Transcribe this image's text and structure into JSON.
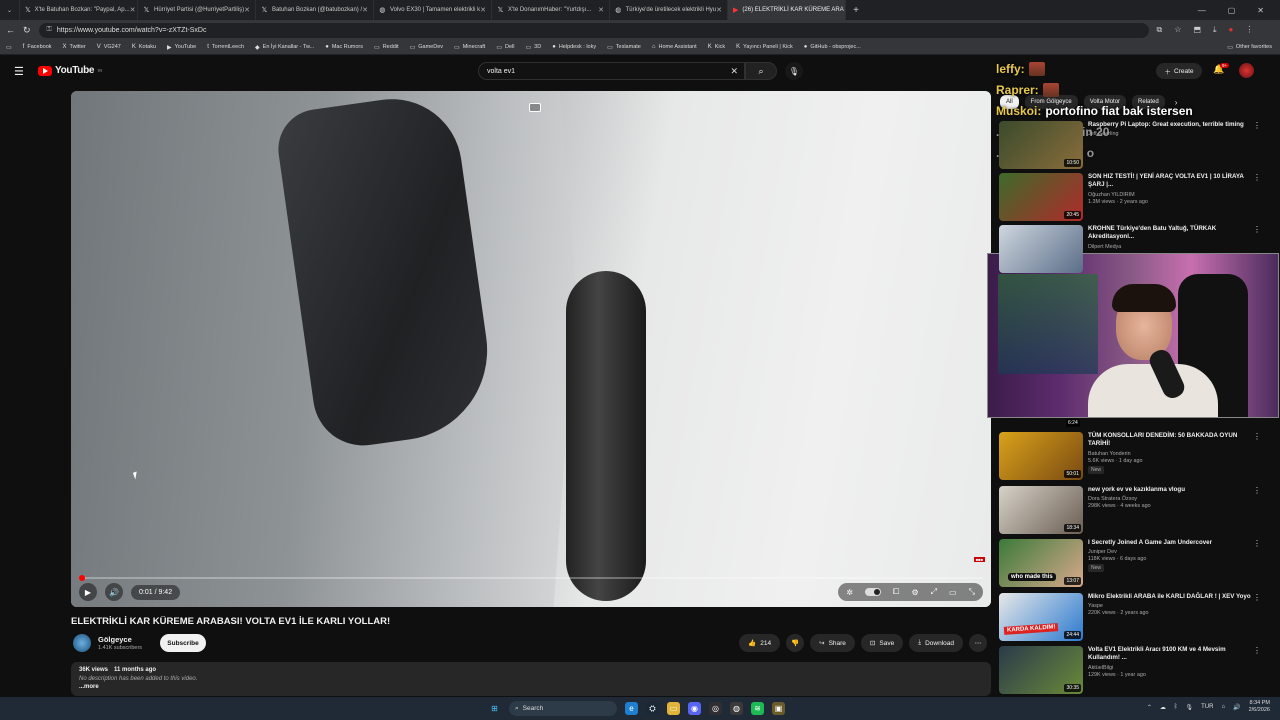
{
  "tabs": [
    {
      "label": "X'te Batuhan Bozkan: \"Paypal, Ap...",
      "icon": "x-icon",
      "active": false
    },
    {
      "label": "Hürriyet Partisi (@HurriyetPartiliş)",
      "icon": "x-icon",
      "active": false
    },
    {
      "label": "Batuhan Bozkan (@batubozkan) /",
      "icon": "x-icon",
      "active": false
    },
    {
      "label": "Volvo EX30 | Tamamen elektrikli k",
      "icon": "globe-icon",
      "active": false
    },
    {
      "label": "X'te DonanımHaber: \"Yurtdışı...",
      "icon": "x-icon",
      "active": false
    },
    {
      "label": "Türkiye'de üretilecek elektrikli Hyu",
      "icon": "globe-icon",
      "active": false
    },
    {
      "label": "(26) ELEKTRİKLİ KAR KÜREME ARA",
      "icon": "youtube-icon",
      "active": true
    }
  ],
  "address": {
    "url": "https://www.youtube.com/watch?v=-zXTZt-SxDc"
  },
  "bookmarks": [
    {
      "label": "Facebook",
      "icon": "f"
    },
    {
      "label": "Twitter",
      "icon": "X"
    },
    {
      "label": "VG247",
      "icon": "V"
    },
    {
      "label": "Kotaku",
      "icon": "K"
    },
    {
      "label": "YouTube",
      "icon": "▶"
    },
    {
      "label": "TorrentLeech",
      "icon": "t"
    },
    {
      "label": "En İyi Kanallar - Tw...",
      "icon": "◆"
    },
    {
      "label": "Mac Rumors",
      "icon": "●"
    },
    {
      "label": "Reddit",
      "icon": "▭"
    },
    {
      "label": "GameDev",
      "icon": "▭"
    },
    {
      "label": "Minecraft",
      "icon": "▭"
    },
    {
      "label": "Dell",
      "icon": "▭"
    },
    {
      "label": "3D",
      "icon": "▭"
    },
    {
      "label": "Helpdesk : loky",
      "icon": "●"
    },
    {
      "label": "Teslamate",
      "icon": "▭"
    },
    {
      "label": "Home Assistant",
      "icon": "⌂"
    },
    {
      "label": "Kick",
      "icon": "K"
    },
    {
      "label": "Yayıncı Paneli | Kick",
      "icon": "K"
    },
    {
      "label": "GitHub - obsprojec...",
      "icon": "●"
    }
  ],
  "bookmarks_other": "Other favorites",
  "youtube": {
    "logo_text": "YouTube",
    "logo_region": "TR",
    "search_value": "volta ev1",
    "create_label": "Create",
    "notif_count": "9+"
  },
  "overlay_chat": [
    {
      "user": "leffy:",
      "msg": "",
      "faded": false
    },
    {
      "user": "Raprer:",
      "msg": "",
      "faded": false
    },
    {
      "user": "Muskoi:",
      "msg": "portofino fiat bak istersen",
      "faded": false
    },
    {
      "user": "",
      "msg": "...2 cm araba için 20",
      "faded": true
    },
    {
      "user": "",
      "msg": "...kaydır napsın o",
      "faded": true
    }
  ],
  "player": {
    "time": "0:01 / 9:42",
    "progress": 0.002
  },
  "video": {
    "title": "ELEKTRİKLİ KAR KÜREME ARABASI! VOLTA EV1 İLE KARLI YOLLAR!",
    "channel": "Gölgeyce",
    "subs": "1.41K subscribers",
    "subscribe_label": "Subscribe",
    "likes": "214",
    "share_label": "Share",
    "save_label": "Save",
    "download_label": "Download",
    "views": "36K views",
    "age": "11 months ago",
    "description": "No description has been added to this video.",
    "more_label": "...more"
  },
  "chips": [
    "All",
    "From Gölgeyce",
    "Volta Motor",
    "Related"
  ],
  "recommendations_top": [
    {
      "title": "Raspberry Pi Laptop: Great execution, terrible timing",
      "channel": "Jeff Geerling",
      "views": "",
      "duration": "10:50",
      "colors": [
        "#3a4b2c",
        "#8a6d3b"
      ]
    },
    {
      "title": "SON HIZ TESTİ! | YENİ ARAÇ VOLTA EV1 | 10 LİRAYA ŞARJ |...",
      "channel": "Oğuzhan YILDIRIM",
      "views": "1.3M views · 2 years ago",
      "duration": "20:45",
      "colors": [
        "#3d6b2a",
        "#b02a2a"
      ]
    },
    {
      "title": "KROHNE Türkiye'den Batu Yaltuğ, TÜRKAK Akreditasyonl...",
      "channel": "Dilpert Medya",
      "views": "",
      "duration": "",
      "colors": [
        "#cfd6df",
        "#5a6e88"
      ]
    }
  ],
  "recommendations_bottom": [
    {
      "title": "TÜM KONSOLLARI DENEDİM: 50 BAKKADA OYUN TARİHİ!",
      "channel": "Batuhan Yonderin",
      "views": "5.6K views · 1 day ago",
      "duration": "50:01",
      "new": "New",
      "colors": [
        "#d9a21a",
        "#7a4a12"
      ]
    },
    {
      "title": "new york ev ve kazıklanma vlogu",
      "channel": "Dora Stratera Özsoy",
      "views": "298K views · 4 weeks ago",
      "duration": "18:34",
      "new": "",
      "colors": [
        "#d7d2c9",
        "#6b5e52"
      ]
    },
    {
      "title": "I Secretly Joined A Game Jam Undercover",
      "channel": "Juniper Dev",
      "views": "118K views · 6 days ago",
      "duration": "13:07",
      "new": "New",
      "colors": [
        "#3b7a3a",
        "#d8a98b"
      ]
    },
    {
      "title": "Mikro Elektrikli ARABA ile KARLI DAĞLAR ! | XEV Yoyo",
      "channel": "Yaspe",
      "views": "220K views · 2 years ago",
      "duration": "24:44",
      "new": "",
      "colors": [
        "#e8e8e8",
        "#2a7ad0"
      ]
    },
    {
      "title": "Volta EV1 Elektrikli Aracı 9100 KM ve 4 Mevsim Kullandım! ...",
      "channel": "AktüelBilgi",
      "views": "129K views · 1 year ago",
      "duration": "30:35",
      "new": "",
      "colors": [
        "#2b3a4a",
        "#6a8a3a"
      ]
    }
  ],
  "hidden_rec_duration": "6:24",
  "thumb_texts": {
    "ev1": "KARDA KALDIM!",
    "juniper": "who made this"
  },
  "taskbar": {
    "search_label": "Search",
    "lang": "TUR",
    "time": "8:34 PM",
    "date": "2/6/2026"
  }
}
